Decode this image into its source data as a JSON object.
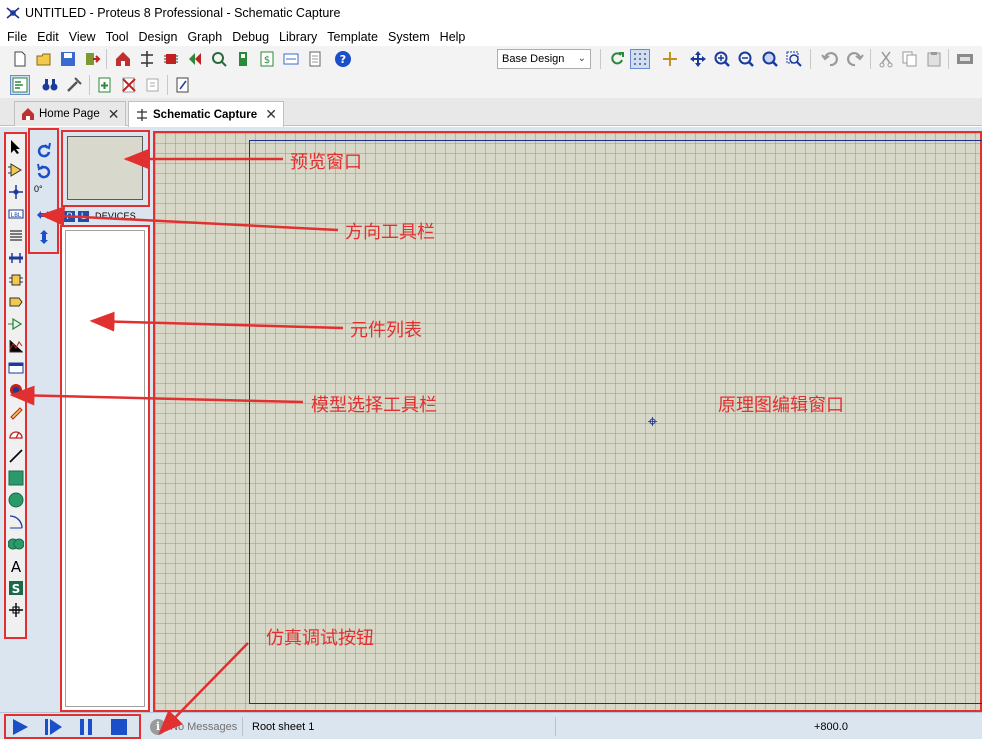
{
  "window": {
    "title": "UNTITLED - Proteus 8 Professional - Schematic Capture"
  },
  "menu": [
    "File",
    "Edit",
    "View",
    "Tool",
    "Design",
    "Graph",
    "Debug",
    "Library",
    "Template",
    "System",
    "Help"
  ],
  "toolbar": {
    "variant_select": "Base Design"
  },
  "tabs": [
    {
      "label": "Home Page"
    },
    {
      "label": "Schematic Capture"
    }
  ],
  "orientation": {
    "angle": "0°"
  },
  "devices": {
    "p_label": "P",
    "l_label": "L",
    "header": "DEVICES"
  },
  "status": {
    "messages": "No Messages",
    "sheet": "Root sheet 1",
    "coordinate": "+800.0"
  },
  "annotations": {
    "preview_window": "预览窗口",
    "orientation_toolbar": "方向工具栏",
    "device_list": "元件列表",
    "mode_toolbar": "模型选择工具栏",
    "schematic_window": "原理图编辑窗口",
    "sim_buttons": "仿真调试按钮"
  },
  "colors": {
    "annotation_red": "#e03030",
    "sheet_border": "#1c2f8c",
    "canvas_bg": "#d8d8c8",
    "panel_bg": "#dbe5ef",
    "sim_blue": "#1a4fc9"
  }
}
